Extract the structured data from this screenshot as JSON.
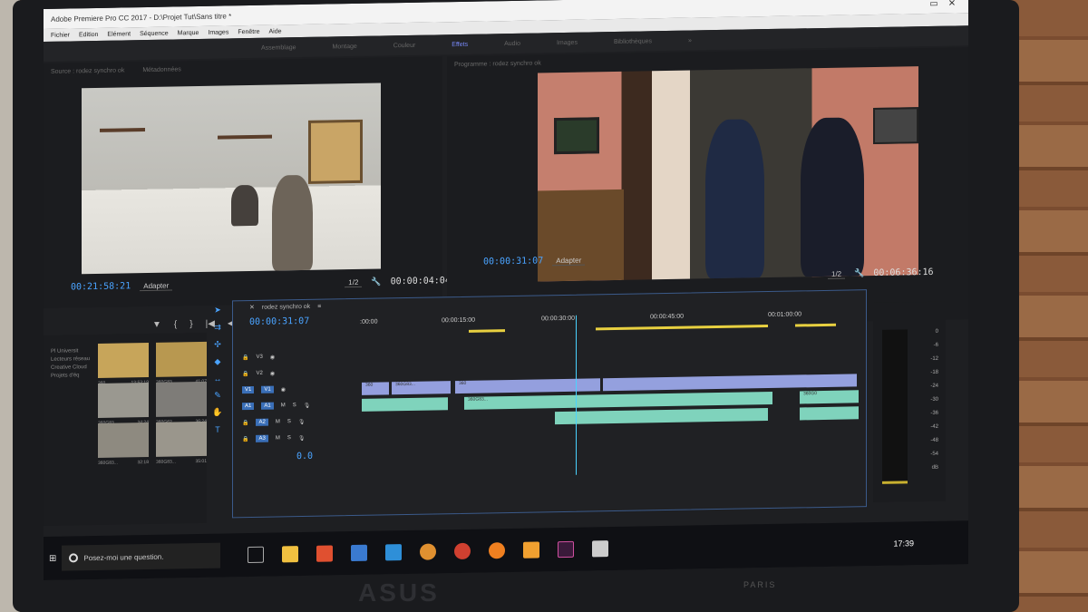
{
  "window": {
    "title": "Adobe Premiere Pro CC 2017 - D:\\Projet Tut\\Sans titre *"
  },
  "menu": [
    "Fichier",
    "Edition",
    "Elément",
    "Séquence",
    "Marque",
    "Images",
    "Fenêtre",
    "Aide"
  ],
  "workspaces": [
    "Assemblage",
    "Montage",
    "Couleur",
    "Effets",
    "Audio",
    "Images",
    "Bibliothèques",
    "»"
  ],
  "source": {
    "tabs": [
      "Source : rodez synchro ok",
      "Métadonnées"
    ],
    "timecode_left": "00:21:58:21",
    "fit": "Adapter",
    "resolution": "1/2",
    "timecode_right": "00:00:04:04"
  },
  "program": {
    "tab": "Programme : rodez synchro ok",
    "timecode_left": "00:00:31:07",
    "fit": "Adapter",
    "resolution": "1/2",
    "timecode_right": "00:06:36:16"
  },
  "project": {
    "tree": [
      "Pl Universit",
      "Lecteurs réseau",
      "Creative Cloud",
      "Projets d'éq"
    ],
    "thumbs": [
      {
        "name": "360...",
        "dur": "13:53:19"
      },
      {
        "name": "360G83...",
        "dur": "41:07"
      },
      {
        "name": "360G83...",
        "dur": "24:24"
      },
      {
        "name": "360G62...",
        "dur": "36:24"
      },
      {
        "name": "360G83...",
        "dur": "32:18"
      },
      {
        "name": "360G83...",
        "dur": "35:01"
      }
    ]
  },
  "timeline": {
    "sequence": "rodez synchro ok",
    "timecode": "00:00:31:07",
    "ruler": [
      ":00:00",
      "00:00:15:00",
      "00:00:30:00",
      "00:00:45:00",
      "00:01:00:00"
    ],
    "tracks": [
      {
        "name": "V3"
      },
      {
        "name": "V2"
      },
      {
        "name": "V1"
      },
      {
        "name": "A1"
      },
      {
        "name": "A2"
      },
      {
        "name": "A3"
      }
    ],
    "src_v": "V1",
    "src_a": "A1",
    "mix_value": "0.0",
    "clip_v_labels": [
      "360",
      "360G83...",
      "360",
      "360G0"
    ],
    "clip_a_labels": [
      "360G83..."
    ],
    "track_btns": [
      "M",
      "S"
    ]
  },
  "meter": {
    "scale": [
      "0",
      "-6",
      "-12",
      "-18",
      "-24",
      "-30",
      "-36",
      "-42",
      "-48",
      "-54",
      "dB"
    ],
    "buttons": [
      "S",
      "S"
    ]
  },
  "taskbar": {
    "search_placeholder": "Posez-moi une question.",
    "time": "17:39"
  },
  "brand": {
    "laptop": "ASUS",
    "tag": "PARIS"
  }
}
